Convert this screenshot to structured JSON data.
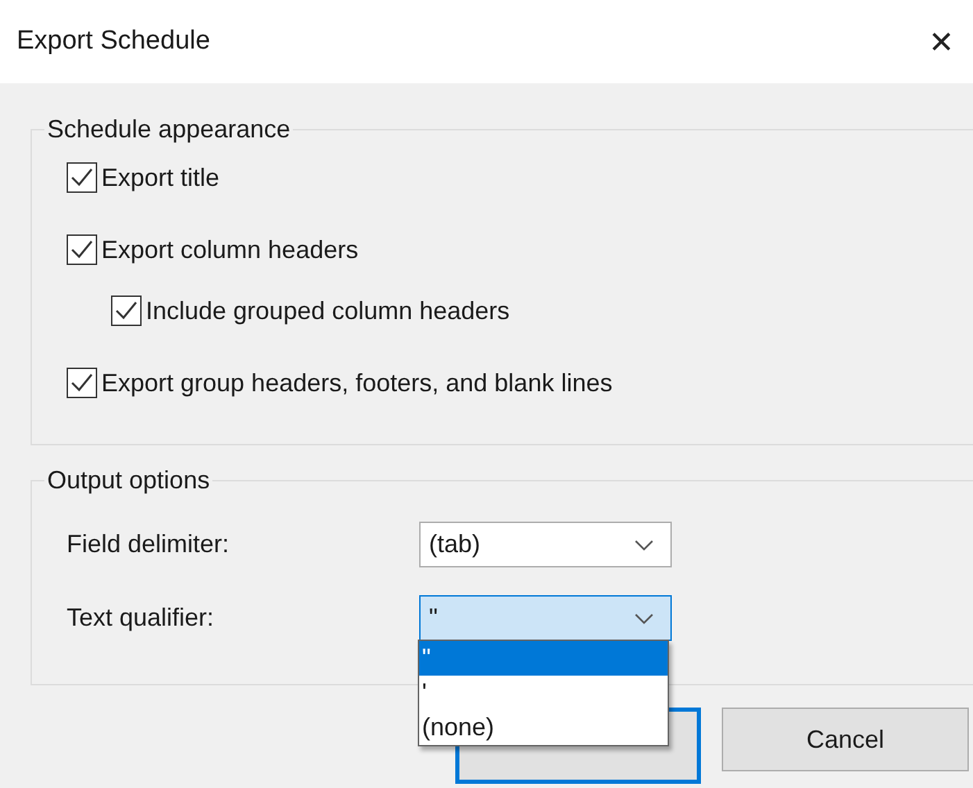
{
  "window": {
    "title": "Export Schedule",
    "close": "✕"
  },
  "groups": [
    {
      "legend": "Schedule appearance",
      "options": [
        {
          "label": "Export title",
          "checked": true
        },
        {
          "label": "Export column headers",
          "checked": true,
          "children": [
            {
              "label": "Include grouped column headers",
              "checked": true
            }
          ]
        },
        {
          "label": "Export group headers, footers, and blank lines",
          "checked": true
        }
      ]
    },
    {
      "legend": "Output options",
      "fields": [
        {
          "label": "Field delimiter:",
          "value": "(tab)",
          "expanded": false
        },
        {
          "label": "Text qualifier:",
          "value": "\"",
          "expanded": true,
          "options": [
            {
              "label": "\"",
              "selected": true
            },
            {
              "label": "'",
              "selected": false
            },
            {
              "label": "(none)",
              "selected": false
            }
          ]
        }
      ]
    }
  ],
  "buttons": [
    {
      "kind": "default"
    },
    {
      "kind": "normal",
      "label": "Cancel"
    }
  ]
}
